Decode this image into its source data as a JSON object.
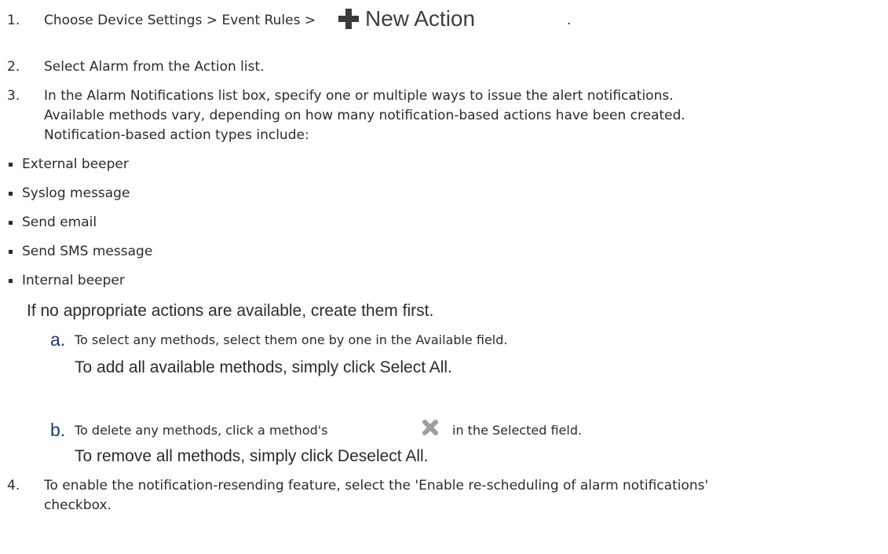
{
  "steps": {
    "s1": {
      "num": "1.",
      "text": "Choose Device Settings > Event Rules >",
      "trail": "."
    },
    "s2": {
      "num": "2.",
      "text": "Select Alarm from the Action list."
    },
    "s3": {
      "num": "3.",
      "line1": "In the Alarm Notifications list box, specify one or multiple ways to issue the alert notifications.",
      "line2": "Available methods vary, depending on how many notification-based actions have been created.",
      "line3": "Notification-based action types include:"
    },
    "s4": {
      "num": "4.",
      "line1": "To enable the notification-resending feature, select the 'Enable re-scheduling of alarm notifications'",
      "line2": "checkbox."
    }
  },
  "new_action_button": {
    "label": "New Action",
    "icon": "plus-icon"
  },
  "bullets": [
    "External beeper",
    "Syslog message",
    "Send email",
    "Send SMS message",
    "Internal beeper"
  ],
  "note": "If no appropriate actions are available, create them first.",
  "substeps": {
    "a": {
      "letter": "a.",
      "text": "To select any methods, select them one by one in the Available field.",
      "note": "To add all available methods, simply click Select All."
    },
    "b": {
      "letter": "b.",
      "text_before": "To delete any methods, click a method's",
      "text_after": "in the Selected field.",
      "icon": "delete-x-icon",
      "note": "To remove all methods, simply click Deselect All."
    }
  }
}
